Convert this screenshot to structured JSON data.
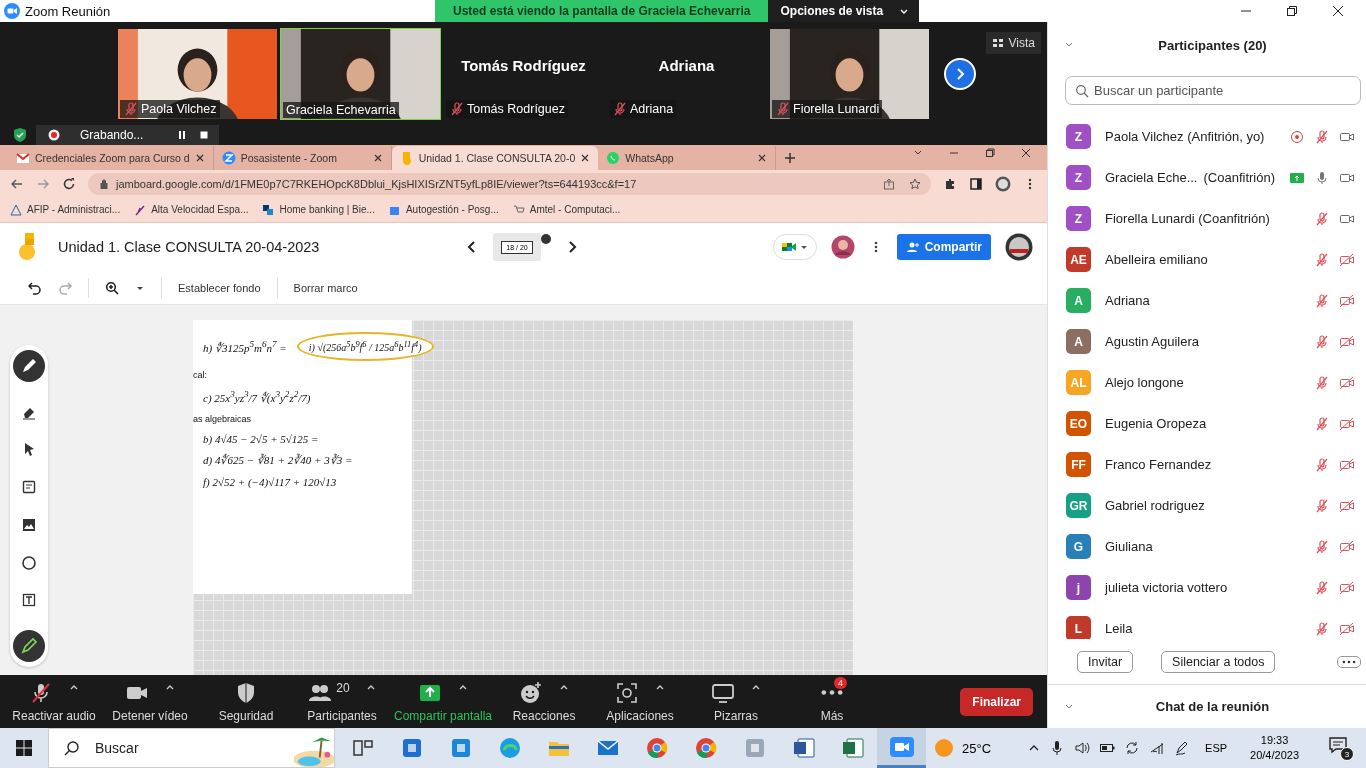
{
  "window": {
    "title": "Zoom Reunión"
  },
  "share_banner": {
    "text": "Usted está viendo la pantalla de Graciela Echevarria",
    "view_options": "Opciones de vista"
  },
  "video_strip": {
    "view_button": "Vista",
    "tiles": [
      {
        "kind": "video",
        "name": "Paola Vilchez",
        "muted": true,
        "selected": false
      },
      {
        "kind": "video",
        "name": "Graciela Echevarria",
        "muted": false,
        "selected": true
      },
      {
        "kind": "name",
        "name": "Tomás Rodríguez",
        "title": "Tomás Rodríguez",
        "muted": true,
        "selected": false
      },
      {
        "kind": "name",
        "name": "Adriana",
        "title": "Adriana",
        "muted": true,
        "selected": false
      },
      {
        "kind": "video",
        "name": "Fiorella Lunardi",
        "muted": true,
        "selected": false
      }
    ]
  },
  "recording": {
    "label": "Grabando..."
  },
  "browser": {
    "tabs": [
      {
        "kind": "gmail",
        "title": "Credenciales Zoom para Curso d",
        "selected": false
      },
      {
        "kind": "zoom",
        "title": "Posasistente - Zoom",
        "selected": false
      },
      {
        "kind": "jamboard",
        "title": "Unidad 1. Clase CONSULTA 20-0",
        "selected": true
      },
      {
        "kind": "whatsapp",
        "title": "WhatsApp",
        "selected": false
      }
    ],
    "url": "jamboard.google.com/d/1FME0p7C7RKEHOpcK8Dblui_KjsHIXISrZNT5yfLp8IE/viewer?ts=644193cc&f=17",
    "bookmarks": [
      {
        "kind": "afip",
        "label": "AFIP - Administraci..."
      },
      {
        "kind": "feather",
        "label": "Alta Velocidad Espa..."
      },
      {
        "kind": "bank",
        "label": "Home banking | Bie..."
      },
      {
        "kind": "puzzle",
        "label": "Autogestión - Posg..."
      },
      {
        "kind": "cart",
        "label": "Amtel - Computaci..."
      }
    ]
  },
  "jamboard": {
    "title": "Unidad 1. Clase CONSULTA 20-04-2023",
    "frame_counter": "18 / 20",
    "share_button": "Compartir",
    "toolbar": [
      "Establecer fondo",
      "Borrar marco"
    ],
    "page": {
      "rows": [
        [
          {
            "kind": "formula",
            "text": "h) ∜3125p$^{5}$m$^{6}$n$^{7}$  =",
            "circled": false
          },
          {
            "kind": "formula",
            "text": "i) √(256a$^{5}$b$^{9}$f$^{6}$ / 125a$^{6}$b$^{11}$f$^{4}$)",
            "circled": true
          }
        ],
        [
          {
            "kind": "label",
            "text": "cal:",
            "circled": false
          }
        ],
        [
          {
            "kind": "formula",
            "text": "c) 25x$^{3}$yz$^{3}$/7 ∜(x$^{3}$y$^{2}$z$^{2}$/7)",
            "circled": false
          }
        ],
        [
          {
            "kind": "label",
            "text": "as algebraicas",
            "circled": false
          }
        ],
        [
          {
            "kind": "formula",
            "text": "b) 4√45 − 2√5 + 5√125 =",
            "circled": false
          }
        ],
        [
          {
            "kind": "formula",
            "text": "d) 4∜625 − ∛81 + 2∛40 + 3∛3 =",
            "circled": false
          }
        ],
        [
          {
            "kind": "formula",
            "text": "f) 2√52 + (−4)√117 + 120√13",
            "circled": false
          }
        ]
      ]
    }
  },
  "zoom_toolbar": {
    "items": [
      {
        "kind": "mic",
        "label": "Reactivar audio",
        "muted": true,
        "caret": true,
        "active": false
      },
      {
        "kind": "camera",
        "label": "Detener vídeo",
        "caret": true,
        "active": false
      },
      {
        "kind": "shield",
        "label": "Seguridad",
        "caret": false,
        "active": false
      },
      {
        "kind": "people",
        "label": "Participantes",
        "count": "20",
        "caret": true,
        "active": false
      },
      {
        "kind": "share",
        "label": "Compartir pantalla",
        "caret": true,
        "active": true
      },
      {
        "kind": "smile",
        "label": "Reacciones",
        "caret": true,
        "active": false
      },
      {
        "kind": "apps",
        "label": "Aplicaciones",
        "caret": true,
        "active": false
      },
      {
        "kind": "board",
        "label": "Pizarras",
        "caret": true,
        "active": false
      },
      {
        "kind": "more",
        "label": "Más",
        "badge": "4",
        "caret": false,
        "active": false
      }
    ],
    "end_button": "Finalizar"
  },
  "participants": {
    "title": "Participantes (20)",
    "search": {
      "placeholder": "Buscar un participante"
    },
    "list": [
      {
        "initials": "Z",
        "color": "#a04fc4",
        "name": "Paola Vilchez (Anfitrión, yo)",
        "recording": true,
        "sharing": false,
        "mic_muted": true,
        "video_on": true
      },
      {
        "initials": "Z",
        "color": "#a04fc4",
        "name": "Graciela Eche...",
        "role": "(Coanfitrión)",
        "recording": false,
        "sharing": true,
        "mic_muted": false,
        "video_on": true
      },
      {
        "initials": "Z",
        "color": "#a04fc4",
        "name": "Fiorella Lunardi (Coanfitrión)",
        "recording": false,
        "sharing": false,
        "mic_muted": true,
        "video_on": true
      },
      {
        "initials": "AE",
        "color": "#c0392b",
        "name": "Abelleira emiliano",
        "recording": false,
        "sharing": false,
        "mic_muted": true,
        "video_on": false
      },
      {
        "initials": "A",
        "color": "#27ae60",
        "name": "Adriana",
        "recording": false,
        "sharing": false,
        "mic_muted": true,
        "video_on": false
      },
      {
        "initials": "A",
        "color": "#8d6e63",
        "name": "Agustin Aguilera",
        "recording": false,
        "sharing": false,
        "mic_muted": true,
        "video_on": false
      },
      {
        "initials": "AL",
        "color": "#f5a623",
        "name": "Alejo longone",
        "recording": false,
        "sharing": false,
        "mic_muted": true,
        "video_on": false
      },
      {
        "initials": "EO",
        "color": "#d35400",
        "name": "Eugenia Oropeza",
        "recording": false,
        "sharing": false,
        "mic_muted": true,
        "video_on": false
      },
      {
        "initials": "FF",
        "color": "#d35400",
        "name": "Franco Fernandez",
        "recording": false,
        "sharing": false,
        "mic_muted": true,
        "video_on": false
      },
      {
        "initials": "GR",
        "color": "#16a085",
        "name": "Gabriel rodriguez",
        "recording": false,
        "sharing": false,
        "mic_muted": true,
        "video_on": false
      },
      {
        "initials": "G",
        "color": "#2980b9",
        "name": "Giuliana",
        "recording": false,
        "sharing": false,
        "mic_muted": true,
        "video_on": false
      },
      {
        "initials": "j",
        "color": "#8e44ad",
        "name": "julieta victoria vottero",
        "recording": false,
        "sharing": false,
        "mic_muted": true,
        "video_on": false
      },
      {
        "initials": "L",
        "color": "#c0392b",
        "name": "Leila",
        "recording": false,
        "sharing": false,
        "mic_muted": true,
        "video_on": false
      }
    ],
    "buttons": [
      "Invitar",
      "Silenciar a todos"
    ],
    "chat_title": "Chat de la reunión"
  },
  "taskbar": {
    "search_placeholder": "Buscar",
    "apps": [
      {
        "kind": "taskview",
        "selected": false
      },
      {
        "kind": "store",
        "selected": false
      },
      {
        "kind": "box",
        "selected": false
      },
      {
        "kind": "edge",
        "selected": false
      },
      {
        "kind": "folder",
        "selected": false
      },
      {
        "kind": "mail",
        "selected": false
      },
      {
        "kind": "chrome",
        "selected": false
      },
      {
        "kind": "chrome",
        "selected": false
      },
      {
        "kind": "photos",
        "selected": false
      },
      {
        "kind": "word",
        "selected": false
      },
      {
        "kind": "excel",
        "selected": false
      },
      {
        "kind": "zoom",
        "selected": true
      }
    ],
    "weather": "25°C",
    "language": "ESP",
    "time": "19:33",
    "date": "20/4/2023",
    "notifications": "3"
  }
}
